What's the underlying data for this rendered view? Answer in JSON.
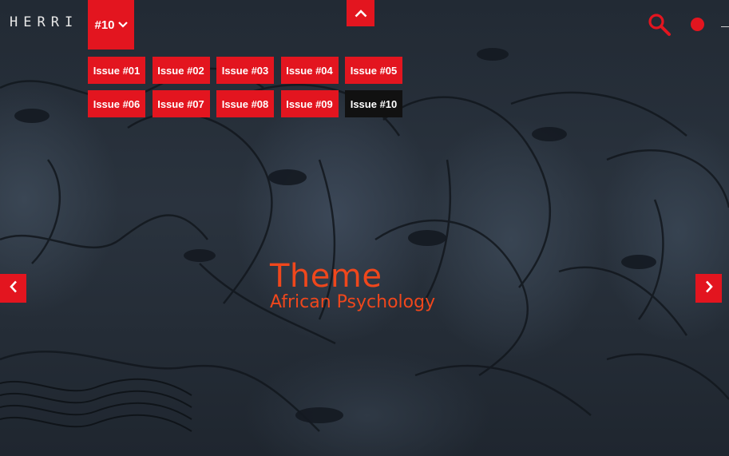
{
  "header": {
    "logo_text": "HERRI",
    "current_issue": "#10"
  },
  "issues": [
    {
      "label": "Issue #01",
      "active": false
    },
    {
      "label": "Issue #02",
      "active": false
    },
    {
      "label": "Issue #03",
      "active": false
    },
    {
      "label": "Issue #04",
      "active": false
    },
    {
      "label": "Issue #05",
      "active": false
    },
    {
      "label": "Issue #06",
      "active": false
    },
    {
      "label": "Issue #07",
      "active": false
    },
    {
      "label": "Issue #08",
      "active": false
    },
    {
      "label": "Issue #09",
      "active": false
    },
    {
      "label": "Issue #10",
      "active": true
    }
  ],
  "theme": {
    "title": "Theme",
    "subtitle": "African Psychology"
  },
  "icons": {
    "toggle": "chevron-down-icon",
    "scroll_up": "chevron-up-icon",
    "search": "search-icon",
    "dot": "menu-dot-icon",
    "prev": "chevron-left-icon",
    "next": "chevron-right-icon"
  },
  "colors": {
    "accent_red": "#e3151f",
    "active_issue_bg": "#111111",
    "title_orange": "#f0471c",
    "background_slate": "#2a333e"
  }
}
